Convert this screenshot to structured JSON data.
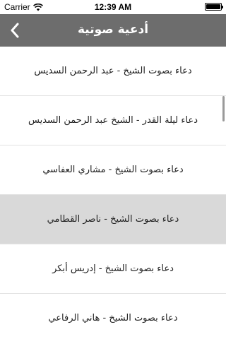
{
  "status_bar": {
    "carrier": "Carrier",
    "time": "12:39 AM",
    "battery_level": 1.0
  },
  "nav": {
    "title": "أدعية صوتية",
    "back_icon": "chevron-left-icon"
  },
  "list": {
    "items": [
      {
        "label": "دعاء بصوت الشيخ - عبد الرحمن السديس"
      },
      {
        "label": "دعاء ليلة القدر - الشيخ عبد الرحمن السديس"
      },
      {
        "label": "دعاء بصوت الشيخ - مشاري العفاسي"
      },
      {
        "label": "دعاء بصوت الشيخ - ناصر القطامي"
      },
      {
        "label": "دعاء بصوت الشيخ - إدريس أبكر"
      },
      {
        "label": "دعاء بصوت الشيخ - هاني الرفاعي"
      }
    ],
    "selected_index": 3
  },
  "colors": {
    "nav_background": "#6d6d6d",
    "selected_row": "#d9d9d9",
    "divider": "#e2e2e2"
  }
}
